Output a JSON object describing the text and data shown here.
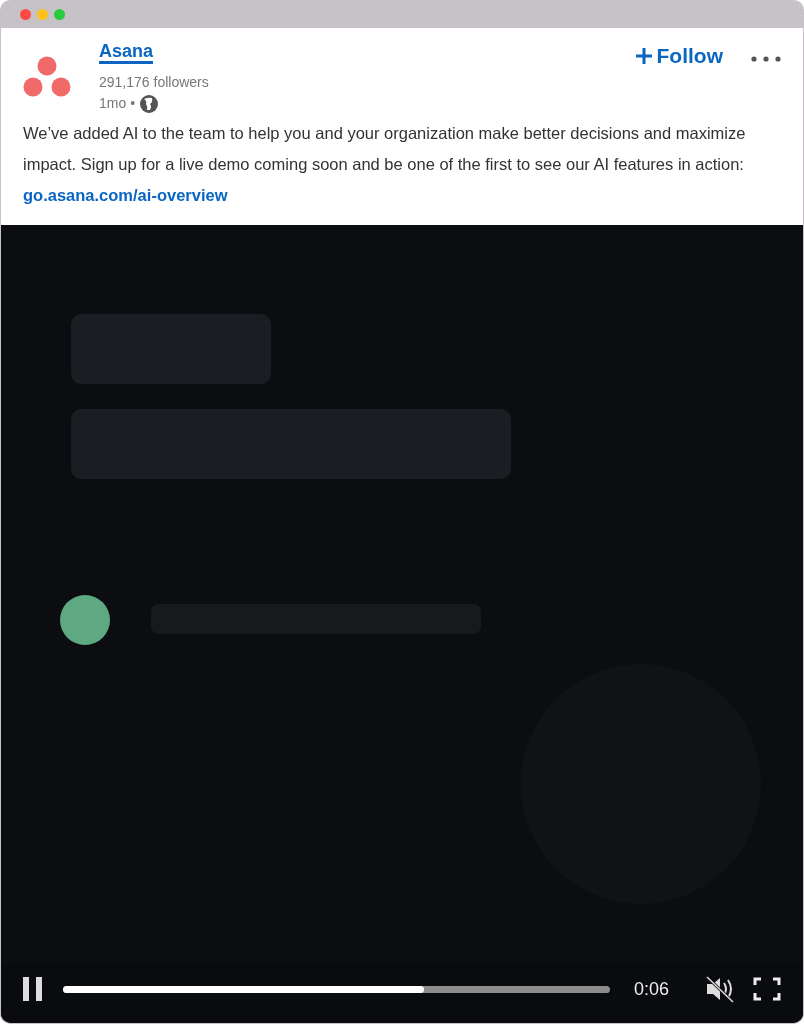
{
  "post": {
    "author": "Asana",
    "followers": "291,176 followers",
    "age": "1mo",
    "separator": "•",
    "follow_label": "Follow",
    "text": "We’ve added AI to the team to help you and your organization make better decisions and maximize impact. Sign up for a live demo coming soon and be one of the first to see our AI features in action: ",
    "link": "go.asana.com/ai-overview"
  },
  "video": {
    "kind": "picture",
    "playing": true,
    "level": 0.66,
    "time": "0:06",
    "muted": true
  }
}
